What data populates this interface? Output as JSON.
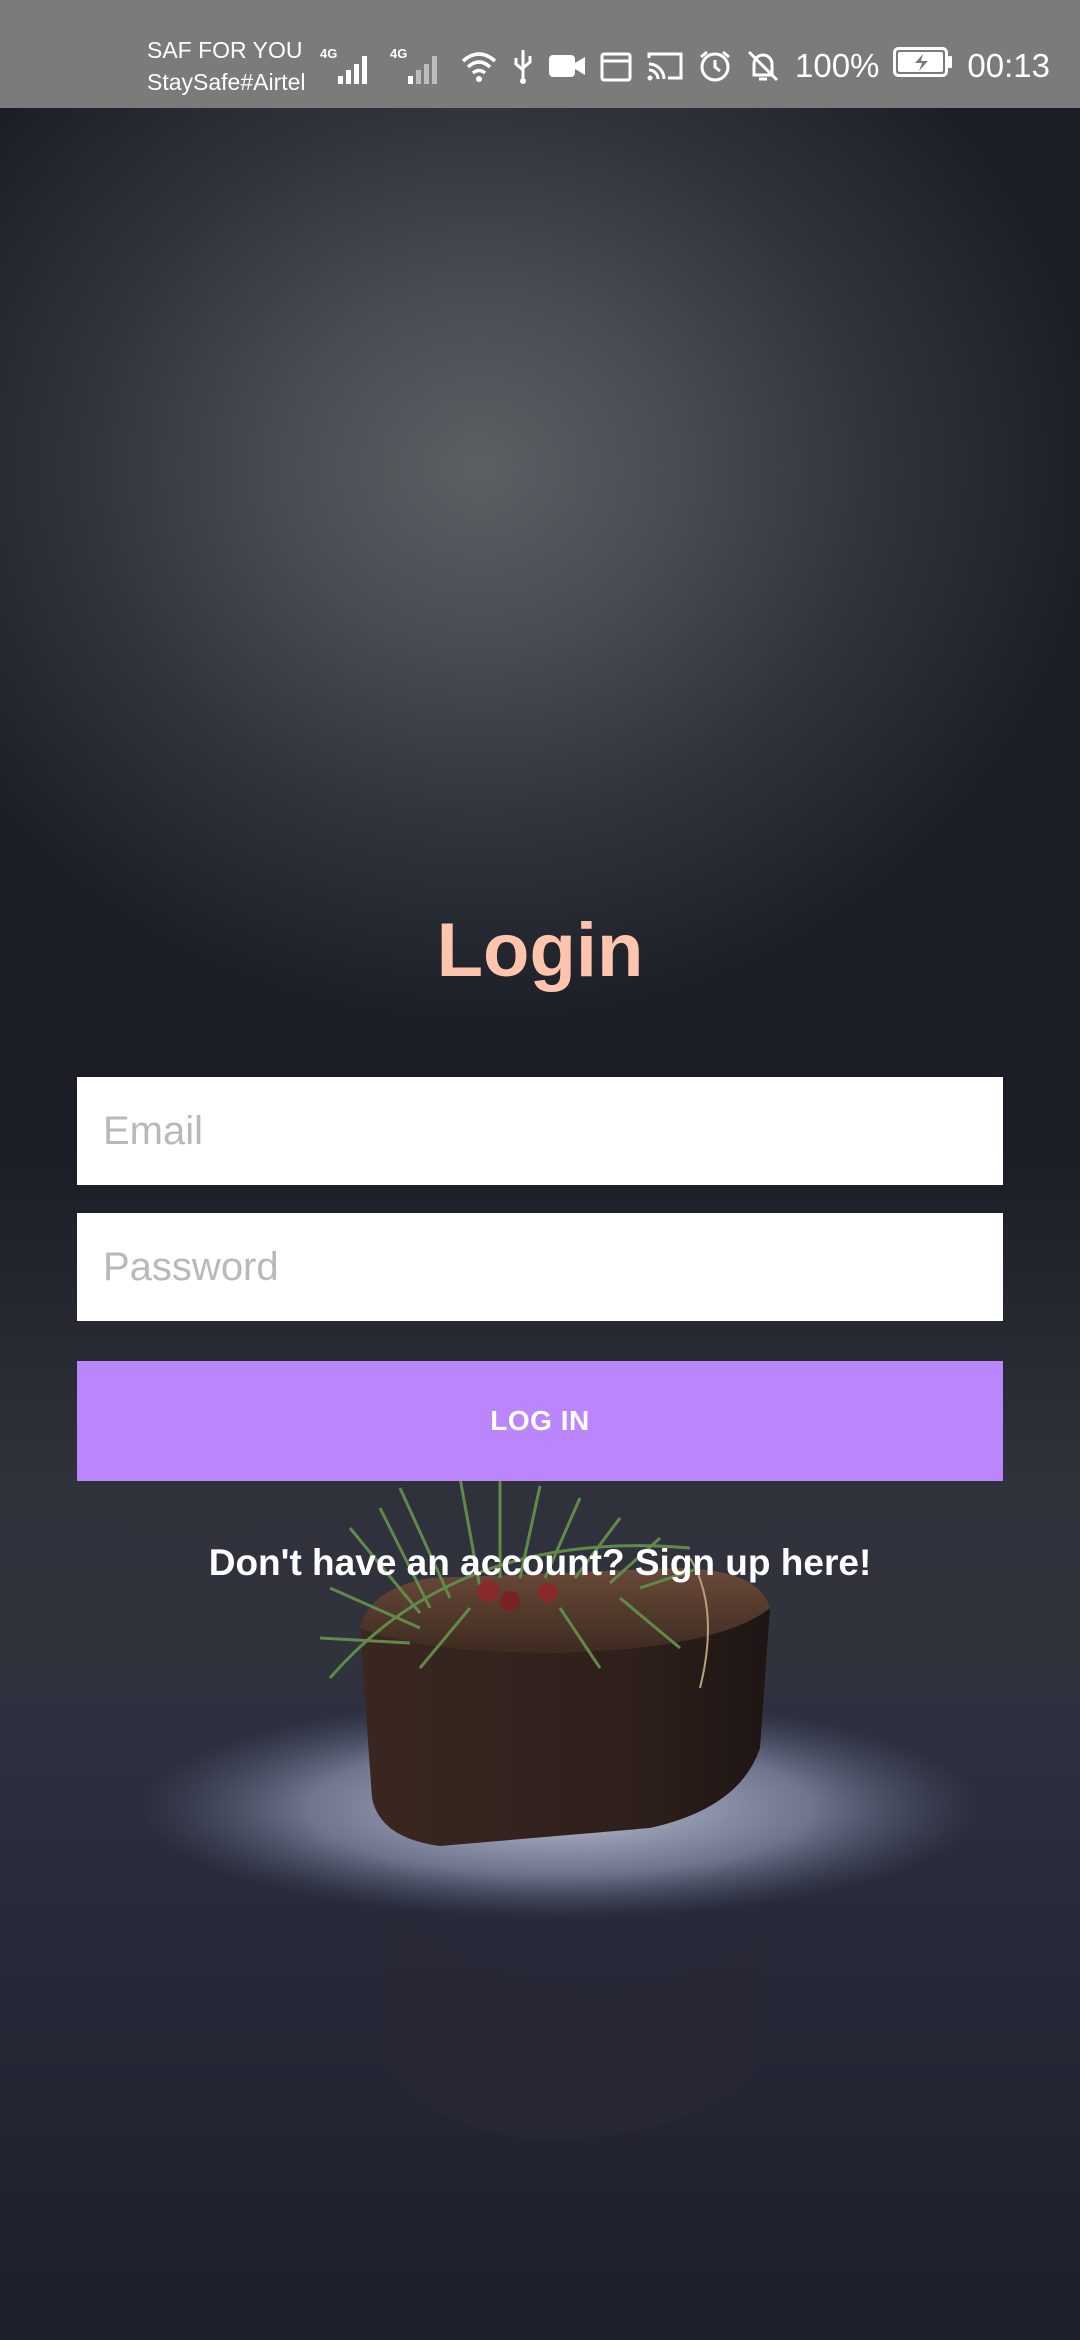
{
  "status_bar": {
    "carrier_line1": "SAF FOR YOU",
    "carrier_line2": "StaySafe#Airtel",
    "network_1": "4G",
    "network_2": "4G",
    "battery_percent": "100%",
    "time": "00:13",
    "icons": [
      "signal-icon",
      "signal-icon",
      "wifi-icon",
      "usb-icon",
      "video-camera-icon",
      "calendar-icon",
      "cast-icon",
      "alarm-icon",
      "bell-off-icon",
      "battery-charging-icon"
    ]
  },
  "login": {
    "title": "Login",
    "email_placeholder": "Email",
    "password_placeholder": "Password",
    "login_button_label": "LOG IN",
    "signup_text": "Don't have an account? Sign up here!"
  },
  "colors": {
    "title": "#ffc4ad",
    "button": "#bb86fc",
    "status_bar": "#7b7b7b"
  }
}
